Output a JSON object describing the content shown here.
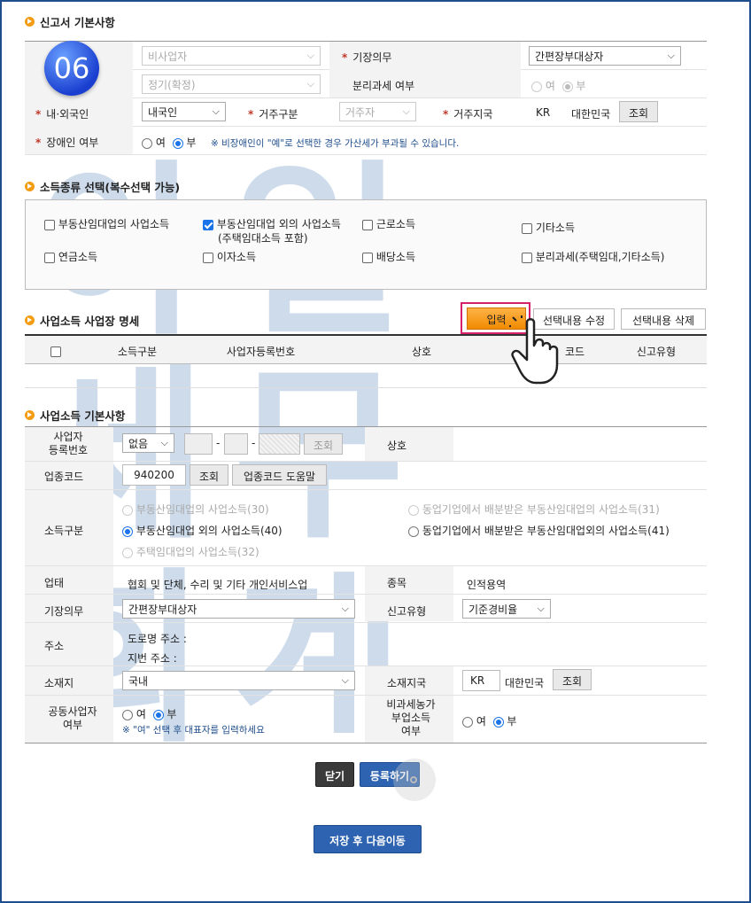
{
  "badge": "06",
  "section1": {
    "title": "신고서 기본사항",
    "row1": {
      "left_select": "비사업자",
      "label": "기장의무",
      "select": "간편장부대상자"
    },
    "row2": {
      "left_select": "정기(확정)",
      "label": "분리과세 여부",
      "opt_yes": "여",
      "opt_no": "부"
    },
    "row3": {
      "label_nation": "내·외국인",
      "nation_select": "내국인",
      "label_residence": "거주구분",
      "residence_select": "거주자",
      "label_country": "거주지국",
      "country_code": "KR",
      "country_name": "대한민국",
      "lookup": "조회"
    },
    "row4": {
      "label": "장애인 여부",
      "opt_yes": "여",
      "opt_no": "부",
      "note": "※ 비장애인이 \"예\"로 선택한 경우 가산세가 부과될 수 있습니다."
    }
  },
  "section2": {
    "title": "소득종류 선택(복수선택 가능)",
    "items": [
      "부동산임대업의 사업소득",
      "부동산임대업 외의 사업소득",
      "(주택임대소득 포함)",
      "근로소득",
      "기타소득",
      "연금소득",
      "이자소득",
      "배당소득",
      "분리과세(주택임대,기타소득)"
    ]
  },
  "section3": {
    "title": "사업소득 사업장 명세",
    "btn_input": "입력",
    "btn_edit": "선택내용 수정",
    "btn_delete": "선택내용 삭제",
    "columns": [
      "소득구분",
      "사업자등록번호",
      "상호",
      "코드",
      "신고유형"
    ]
  },
  "section4": {
    "title": "사업소득 기본사항",
    "reg_label": "사업자\n등록번호",
    "reg_select": "없음",
    "lookup": "조회",
    "name_label": "상호",
    "industry_label": "업종코드",
    "industry_code": "940200",
    "industry_help": "업종코드 도움말",
    "income_label": "소득구분",
    "income_opts": [
      "부동산임대업의 사업소득(30)",
      "부동산임대업 외의 사업소득(40)",
      "주택임대업의 사업소득(32)",
      "동업기업에서 배분받은 부동산임대업의 사업소득(31)",
      "동업기업에서 배분받은 부동산임대업외의 사업소득(41)"
    ],
    "biz_label": "업태",
    "biz_value": "협회 및 단체, 수리 및 기타 개인서비스업",
    "item_label": "종목",
    "item_value": "인적용역",
    "bookkeeping_label": "기장의무",
    "bookkeeping_select": "간편장부대상자",
    "report_label": "신고유형",
    "report_select": "기준경비율",
    "address_label": "주소",
    "road_address": "도로명 주소 :",
    "lot_address": "지번 주소 :",
    "location_label": "소재지",
    "location_select": "국내",
    "country_label": "소재지국",
    "country_code": "KR",
    "country_name": "대한민국",
    "joint_label": "공동사업자\n여부",
    "joint_yes": "여",
    "joint_no": "부",
    "joint_note": "※ \"여\" 선택 후 대표자를 입력하세요",
    "nontax_label": "비과세농가\n부업소득\n여부",
    "nontax_yes": "여",
    "nontax_no": "부"
  },
  "footer": {
    "close": "닫기",
    "register": "등록하기",
    "save_next": "저장 후 다음이동"
  },
  "watermark": {
    "line1": "아일",
    "line2": "세무",
    "line3": "회계"
  }
}
